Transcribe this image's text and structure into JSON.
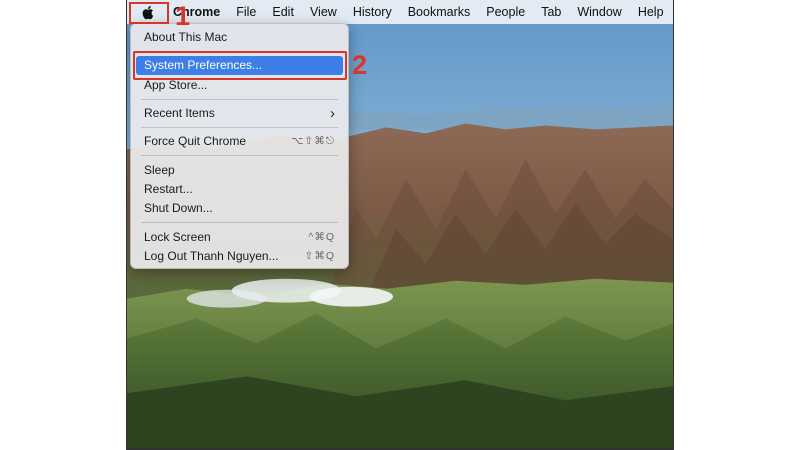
{
  "menubar": {
    "apple_icon": "apple-logo-icon",
    "items": [
      "Chrome",
      "File",
      "Edit",
      "View",
      "History",
      "Bookmarks",
      "People",
      "Tab",
      "Window",
      "Help"
    ]
  },
  "apple_menu": {
    "about": "About This Mac",
    "system_prefs": "System Preferences...",
    "app_store": "App Store...",
    "recent_items": "Recent Items",
    "recent_chevron": "›",
    "force_quit": "Force Quit Chrome",
    "force_quit_shortcut": "⌥⇧⌘⎋",
    "sleep": "Sleep",
    "restart": "Restart...",
    "shut_down": "Shut Down...",
    "lock_screen": "Lock Screen",
    "lock_shortcut": "^⌘Q",
    "log_out": "Log Out Thanh Nguyen...",
    "log_out_shortcut": "⇧⌘Q"
  },
  "annotations": {
    "step1": "1",
    "step2": "2",
    "color": "#d9362b"
  },
  "colors": {
    "highlight": "#3d7fe6",
    "sky": "#8ab6d9",
    "hills": "#5f7a3a"
  }
}
